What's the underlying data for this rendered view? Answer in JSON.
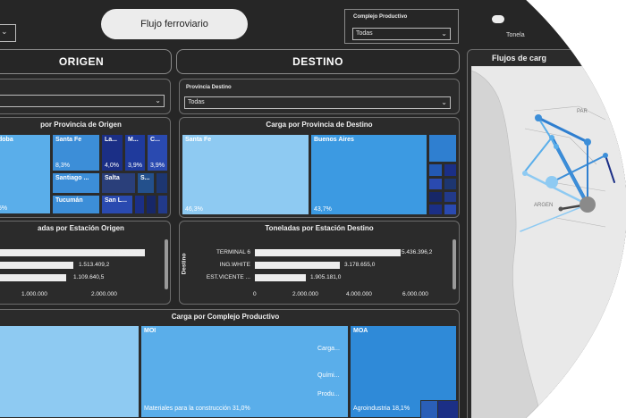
{
  "header": {
    "flujo_button": "Flujo ferroviario",
    "complejo_label": "Complejo Productivo",
    "complejo_value": "Todas",
    "right_small_label": "Tonela",
    "origen_title": "ORIGEN",
    "destino_title": "DESTINO"
  },
  "slicers": {
    "provincia_destino_label": "Provincia Destino",
    "provincia_destino_value": "Todas"
  },
  "carga_origen": {
    "title": "por Provincia de Origen",
    "tiles": [
      {
        "label": "doba",
        "pct": "5%"
      },
      {
        "label": "Santa Fe",
        "pct": "8,3%"
      },
      {
        "label": "La...",
        "pct": "4,0%"
      },
      {
        "label": "M...",
        "pct": "3,9%"
      },
      {
        "label": "C...",
        "pct": "3,9%"
      },
      {
        "label": "Santiago ...",
        "pct": ""
      },
      {
        "label": "Salta",
        "pct": ""
      },
      {
        "label": "S...",
        "pct": ""
      },
      {
        "label": "Tucumán",
        "pct": ""
      },
      {
        "label": "San L...",
        "pct": ""
      }
    ]
  },
  "carga_destino": {
    "title": "Carga por Provincia de Destino",
    "tiles": [
      {
        "label": "Santa Fe",
        "pct": "46,3%"
      },
      {
        "label": "Buenos Aires",
        "pct": "43,7%"
      }
    ]
  },
  "ton_origen": {
    "title": "adas por Estación Origen",
    "values": [
      "2.050.212,4",
      "1.513.409,2",
      "1.109.640,5"
    ],
    "ticks": [
      "1.000.000",
      "2.000.000"
    ]
  },
  "ton_destino": {
    "title": "Toneladas por Estación Destino",
    "axis_label": "Destino",
    "rows": [
      {
        "label": "TERMINAL 6",
        "value": "5.436.396,2"
      },
      {
        "label": "ING.WHITE",
        "value": "3.178.655,0"
      },
      {
        "label": "EST.VICENTE ...",
        "value": "1.905.181,0"
      }
    ],
    "ticks": [
      "0",
      "2.000.000",
      "4.000.000",
      "6.000.000"
    ]
  },
  "complejo_chart": {
    "title": "Carga por Complejo Productivo",
    "tiles": [
      {
        "label": "MOI",
        "pct": "Materiales para la construcción 31,0%"
      },
      {
        "label": "Carga...",
        "pct": ""
      },
      {
        "label": "Quími...",
        "pct": ""
      },
      {
        "label": "Produ...",
        "pct": ""
      },
      {
        "label": "MOA",
        "pct": "Agroindustria 18,1%"
      }
    ]
  },
  "map": {
    "title": "Flujos de carg",
    "place_1": "PAR",
    "place_2": "ARGEN"
  },
  "colors": {
    "background": "#262626",
    "light_blue": "#5aaeea",
    "pale_blue": "#8ecaf2",
    "mid_blue": "#3c8ed8",
    "navy": "#1b2f86",
    "dark_navy": "#172767",
    "bar": "#ededed"
  }
}
